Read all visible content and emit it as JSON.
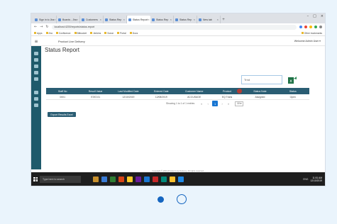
{
  "browser": {
    "tabs": [
      {
        "label": "Sign in to Jira"
      },
      {
        "label": "Boards - Jira"
      },
      {
        "label": "Customers"
      },
      {
        "label": "Status Rep"
      },
      {
        "label": "Status Report",
        "active": true
      },
      {
        "label": "Status Rep"
      },
      {
        "label": "Status Rep"
      },
      {
        "label": "New tab"
      }
    ],
    "new_tab": "+",
    "window_controls": [
      "–",
      "□",
      "×"
    ],
    "url": "localhost:4200/reports/status-report",
    "bookmarks": [
      "Apps",
      "Jira",
      "Confluence",
      "Bitbucket",
      "Jenkins",
      "Sonar",
      "Portal",
      "Docs"
    ],
    "bookmarks_right": "Other bookmarks",
    "extension_colors": [
      "#4285f4",
      "#ea4335",
      "#fbbc05",
      "#34a853",
      "#888888"
    ]
  },
  "app": {
    "menu_icon": "hamburger-icon",
    "brand": "Product Live Delivery",
    "welcome": "Welcome Admin User ▾",
    "page_title": "Status Report",
    "search_value": "Trnd",
    "export_icon": "excel-export-icon",
    "table": {
      "headers": [
        "Staff No",
        "Result Value",
        "Last Modified Date",
        "Entered Date",
        "Customer Name",
        "Product",
        "Status Note",
        "Status"
      ],
      "highlight_header_index": 5,
      "rows": [
        [
          "0001",
          "STAT-01",
          "12/10/2019",
          "12/08/2019",
          "ACCUSAGE",
          "EQ Trans",
          "Assigned",
          "Open"
        ]
      ]
    },
    "pager": {
      "info": "Showing 1 to 1 of 1 entries",
      "first": "«",
      "prev": "‹",
      "current": "1",
      "next": "›",
      "last": "»",
      "page_size": "10 ▾"
    },
    "download_button": "Export Results Excel",
    "footer": "Copyright © 2019 Product Live Delivery. All rights reserved."
  },
  "taskbar": {
    "search_placeholder": "Type here to search",
    "icon_colors": [
      "#c8902c",
      "#3a7bd5",
      "#2e7d32",
      "#d84315",
      "#ffca28",
      "#6a1b9a",
      "#1976d2",
      "#c62828",
      "#00897b",
      "#fbc02d",
      "#1e88e5"
    ],
    "tray_text": "ENG",
    "time": "11:51 AM",
    "date": "12/10/2019"
  },
  "carousel": {
    "active_index": 0,
    "count": 2,
    "accent": "#1565c0"
  }
}
